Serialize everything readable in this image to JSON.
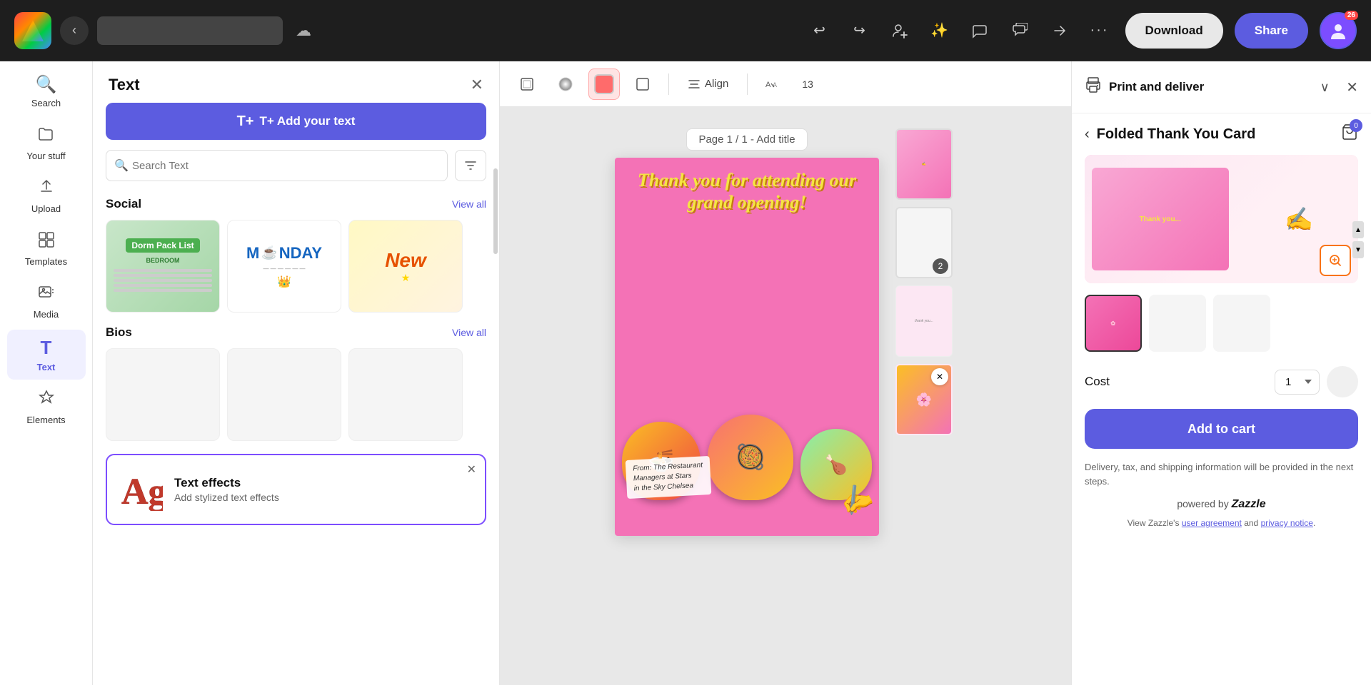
{
  "app": {
    "logo_alt": "Canva logo"
  },
  "topbar": {
    "back_btn": "‹",
    "title_placeholder": "",
    "cloud_icon": "☁",
    "undo_icon": "↩",
    "redo_icon": "↪",
    "add_collaborator_icon": "👤+",
    "magic_icon": "✨",
    "comment_icon": "💬",
    "comments_icon": "🗨",
    "share_template_icon": "🔗",
    "more_icon": "…",
    "download_label": "Download",
    "share_label": "Share",
    "avatar_count": "26"
  },
  "sidebar": {
    "items": [
      {
        "id": "search",
        "icon": "🔍",
        "label": "Search"
      },
      {
        "id": "your-stuff",
        "icon": "📁",
        "label": "Your stuff"
      },
      {
        "id": "upload",
        "icon": "⬆",
        "label": "Upload"
      },
      {
        "id": "templates",
        "icon": "⊞",
        "label": "Templates"
      },
      {
        "id": "media",
        "icon": "🎬",
        "label": "Media"
      },
      {
        "id": "text",
        "icon": "T",
        "label": "Text",
        "active": true
      },
      {
        "id": "elements",
        "icon": "✦",
        "label": "Elements"
      }
    ]
  },
  "text_panel": {
    "title": "Text",
    "close_icon": "✕",
    "add_text_label": "T+ Add your text",
    "search_placeholder": "Search Text",
    "filter_icon": "⚗",
    "sections": [
      {
        "id": "social",
        "title": "Social",
        "view_all": "View all",
        "cards": [
          {
            "id": "dorm",
            "type": "green",
            "title": "Dorm Pack List",
            "subtitle": "BEDROOM"
          },
          {
            "id": "monday",
            "type": "text",
            "content": "MONDAY"
          },
          {
            "id": "new",
            "type": "yellow",
            "content": "New"
          }
        ]
      },
      {
        "id": "bios",
        "title": "Bios",
        "view_all": "View all"
      }
    ],
    "text_effects": {
      "ag_text": "Ag",
      "title": "Text effects",
      "subtitle": "Add stylized text effects",
      "close_icon": "✕"
    }
  },
  "canvas_toolbar": {
    "frame_icon": "⊡",
    "color_wheel_icon": "🎨",
    "color_swatch": "#ff6b6b",
    "border_icon": "⊟",
    "align_label": "Align",
    "translate_icon": "A→",
    "font_size": "13"
  },
  "canvas": {
    "page_label": "Page 1 / 1 - Add title",
    "design": {
      "headline": "Thank you for attending our grand opening!",
      "from_text": "From: The Restaurant\nManagers at Stars\nin the Sky Chelsea",
      "food_emojis": "🍜🥘🍗"
    }
  },
  "right_panel": {
    "print_icon": "🖨",
    "title": "Print and deliver",
    "chevron_icon": "∨",
    "close_icon": "✕",
    "back_icon": "‹",
    "product_title": "Folded Thank You Card",
    "cart_icon": "🛒",
    "cart_count": "0",
    "zoom_icon": "⊕",
    "cost_label": "Cost",
    "qty_default": "1",
    "add_to_cart_label": "Add to cart",
    "delivery_text": "Delivery, tax, and shipping information will be provided in the next steps.",
    "powered_by_prefix": "powered by ",
    "powered_by_brand": "Zazzle",
    "legal_prefix": "View Zazzle's ",
    "legal_link1": "user agreement",
    "legal_middle": " and ",
    "legal_link2": "privacy notice",
    "legal_suffix": "."
  }
}
